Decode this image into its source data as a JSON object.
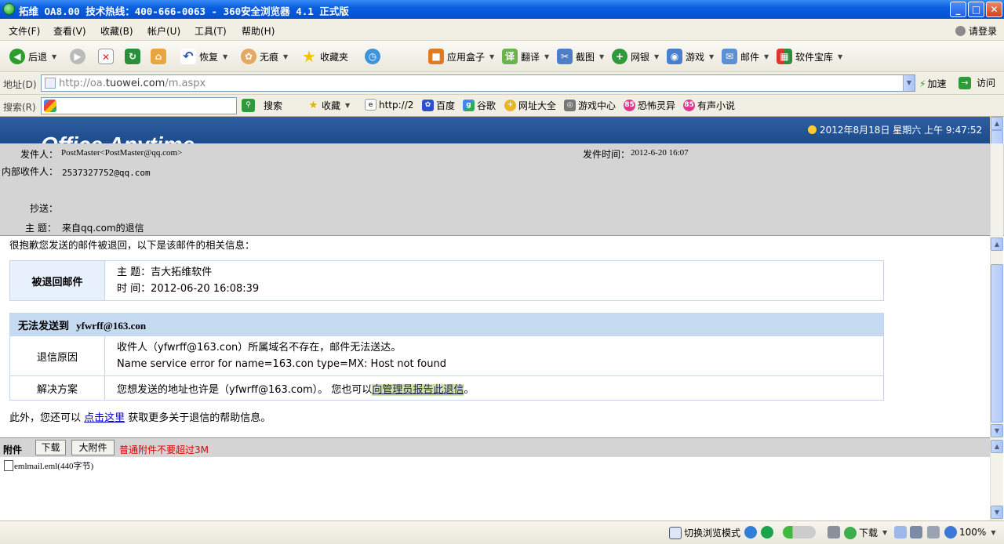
{
  "window": {
    "title": "拓维 OA8.00 技术热线：400-666-0063 - 360安全浏览器 4.1 正式版",
    "min": "_",
    "max": "□",
    "close": "✕"
  },
  "menu": [
    "文件(F)",
    "查看(V)",
    "收藏(B)",
    "帐户(U)",
    "工具(T)",
    "帮助(H)"
  ],
  "login": "请登录",
  "toolbar": {
    "back": "后退",
    "restore": "恢复",
    "incognito": "无痕",
    "favorites": "收藏夹",
    "appbox": "应用盒子",
    "translate": "翻译",
    "screenshot": "截图",
    "bank": "网银",
    "games": "游戏",
    "mail": "邮件",
    "software": "软件宝库"
  },
  "address": {
    "label": "地址(D)",
    "url_host": "http://oa.",
    "url_domain": "tuowei.com",
    "url_path": "/m.aspx",
    "speedup": "加速",
    "go": "访问"
  },
  "search": {
    "label": "搜索(R)",
    "placeholder": "",
    "button": "搜索"
  },
  "favbar": [
    "收藏",
    "http://2",
    "百度",
    "谷歌",
    "网址大全",
    "游戏中心",
    "恐怖灵异",
    "有声小说"
  ],
  "banner": {
    "logo": "Office Anytime",
    "datetime": "2012年8月18日  星期六   上午  9:47:52"
  },
  "mail": {
    "from_label": "发件人：",
    "from": "PostMaster<PostMaster@qq.com>",
    "sent_label": "发件时间：",
    "sent": "2012-6-20 16:07",
    "to_label": "内部收件人：",
    "to": "2537327752@qq.com",
    "cc_label": "抄送：",
    "cc": "",
    "subject_label": "主 题：",
    "subject": "来自qq.com的退信"
  },
  "bounce": {
    "intro": "很抱歉您发送的邮件被退回，以下是该邮件的相关信息：",
    "returned_label": "被退回邮件",
    "subject_line": "主 题：吉大拓维软件",
    "time_line": "时 间：2012-06-20 16:08:39",
    "cannot_label": "无法发送到",
    "cannot_addr": "yfwrff@163.con",
    "reason_label": "退信原因",
    "reason_1": "收件人（yfwrff@163.con）所属域名不存在，邮件无法送达。",
    "reason_2": "Name service error for name=163.con type=MX: Host not found",
    "solution_label": "解决方案",
    "solution_text": "您想发送的地址也许是（yfwrff@163.com）。 您也可以",
    "solution_link": "向管理员报告此退信",
    "solution_end": "。",
    "footer_pre": "此外，您还可以 ",
    "footer_link": "点击这里",
    "footer_post": " 获取更多关于退信的帮助信息。"
  },
  "attachments": {
    "label": "附件",
    "download": "下载",
    "big": "大附件",
    "note": "普通附件不要超过3M",
    "file": "emlmail.eml(440字节)"
  },
  "status": {
    "switch_mode": "切换浏览模式",
    "download": "下载",
    "zoom": "100%"
  }
}
